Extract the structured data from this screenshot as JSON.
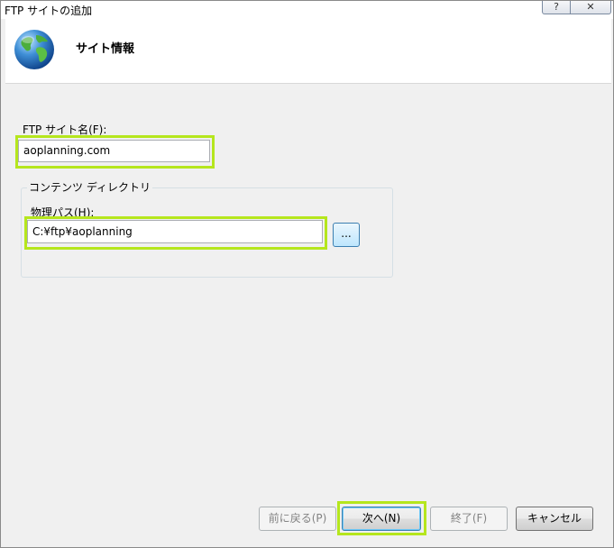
{
  "window": {
    "title": "FTP サイトの追加",
    "help_glyph": "?",
    "close_glyph": "✕"
  },
  "header": {
    "title": "サイト情報",
    "icon": "globe-icon"
  },
  "site_name": {
    "label": "FTP サイト名(F):",
    "value": "aoplanning.com"
  },
  "content_directory": {
    "caption": "コンテンツ ディレクトリ",
    "path_label": "物理パス(H):",
    "path_value": "C:¥ftp¥aoplanning",
    "browse_label": "..."
  },
  "buttons": {
    "previous": "前に戻る(P)",
    "next": "次へ(N)",
    "finish": "終了(F)",
    "cancel": "キャンセル"
  },
  "colors": {
    "highlight": "#b5e61d",
    "focus": "#3c7fb1"
  }
}
